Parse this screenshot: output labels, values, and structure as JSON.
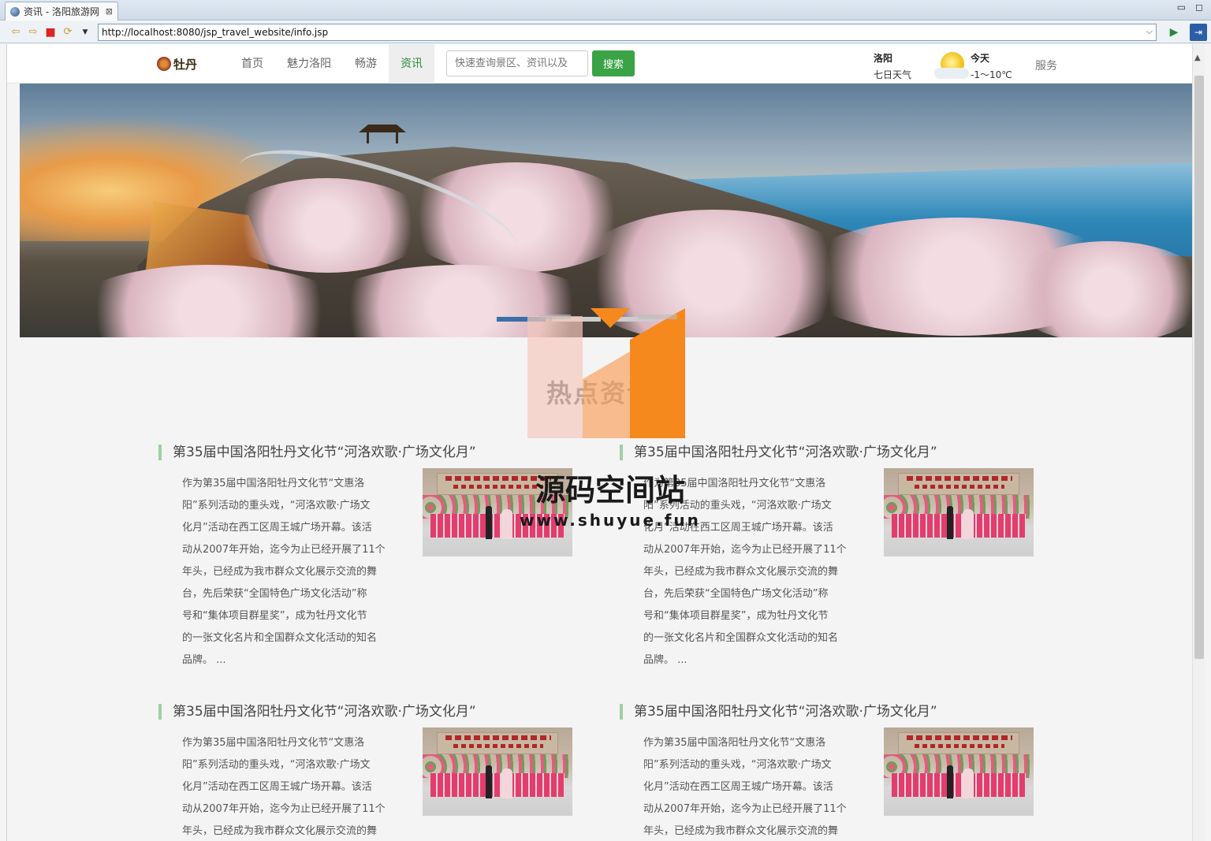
{
  "browser": {
    "tab_title": "资讯 - 洛阳旅游网",
    "tab_close": "⊠",
    "url": "http://localhost:8080/jsp_travel_website/info.jsp"
  },
  "site": {
    "logo_text": "牡丹",
    "nav": [
      {
        "label": "首页",
        "active": false
      },
      {
        "label": "魅力洛阳",
        "active": false
      },
      {
        "label": "畅游",
        "active": false
      },
      {
        "label": "资讯",
        "active": true
      }
    ],
    "search": {
      "placeholder": "快速查询景区、资讯以及",
      "button_label": "搜索"
    },
    "weather": {
      "city": "洛阳",
      "week_link": "七日天气",
      "today_label": "今天",
      "temp": "-1～10℃"
    },
    "service_label": "服务",
    "accent_color": "#3aa346"
  },
  "section": {
    "title": "热点资讯"
  },
  "watermark": {
    "text": "源码空间站",
    "url": "www.shuyue.fun"
  },
  "news": [
    {
      "title": "第35届中国洛阳牡丹文化节“河洛欢歌·广场文化月”",
      "lines": [
        "作为第35届中国洛阳牡丹文化节“文惠洛",
        "阳”系列活动的重头戏，“河洛欢歌·广场文",
        "化月”活动在西工区周王城广场开幕。该活",
        "动从2007年开始，迄今为止已经开展了11个",
        "年头，已经成为我市群众文化展示交流的舞",
        "台，先后荣获“全国特色广场文化活动”称",
        "号和“集体项目群星奖”，成为牡丹文化节",
        "的一张文化名片和全国群众文化活动的知名",
        "品牌。 ..."
      ]
    },
    {
      "title": "第35届中国洛阳牡丹文化节“河洛欢歌·广场文化月”",
      "lines": [
        "作为第35届中国洛阳牡丹文化节“文惠洛",
        "阳”系列活动的重头戏，“河洛欢歌·广场文",
        "化月”活动在西工区周王城广场开幕。该活",
        "动从2007年开始，迄今为止已经开展了11个",
        "年头，已经成为我市群众文化展示交流的舞",
        "台，先后荣获“全国特色广场文化活动”称",
        "号和“集体项目群星奖”，成为牡丹文化节",
        "的一张文化名片和全国群众文化活动的知名",
        "品牌。 ..."
      ]
    },
    {
      "title": "第35届中国洛阳牡丹文化节“河洛欢歌·广场文化月”",
      "lines": [
        "作为第35届中国洛阳牡丹文化节“文惠洛",
        "阳”系列活动的重头戏，“河洛欢歌·广场文",
        "化月”活动在西工区周王城广场开幕。该活",
        "动从2007年开始，迄今为止已经开展了11个",
        "年头，已经成为我市群众文化展示交流的舞"
      ]
    },
    {
      "title": "第35届中国洛阳牡丹文化节“河洛欢歌·广场文化月”",
      "lines": [
        "作为第35届中国洛阳牡丹文化节“文惠洛",
        "阳”系列活动的重头戏，“河洛欢歌·广场文",
        "化月”活动在西工区周王城广场开幕。该活",
        "动从2007年开始，迄今为止已经开展了11个",
        "年头，已经成为我市群众文化展示交流的舞"
      ]
    }
  ]
}
